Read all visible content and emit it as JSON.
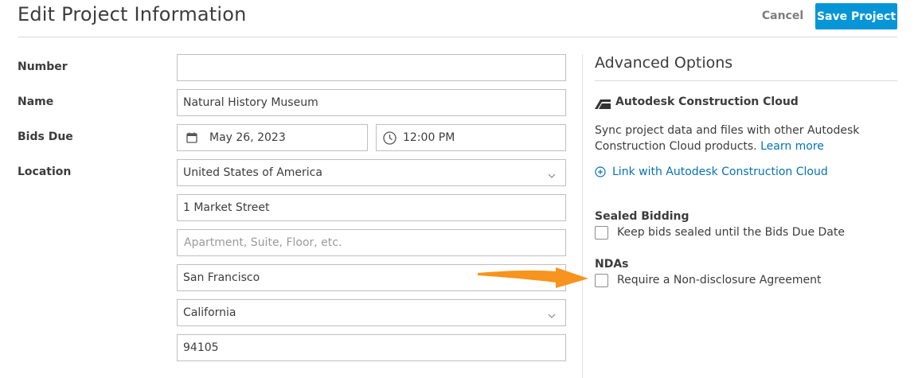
{
  "header": {
    "title": "Edit Project Information",
    "cancel_label": "Cancel",
    "save_label": "Save Project"
  },
  "form": {
    "number": {
      "label": "Number",
      "value": ""
    },
    "name": {
      "label": "Name",
      "value": "Natural History Museum"
    },
    "bids_due": {
      "label": "Bids Due",
      "date": "May 26, 2023",
      "time": "12:00 PM",
      "date_icon": "calendar-icon",
      "time_icon": "clock-icon"
    },
    "location": {
      "label": "Location",
      "country": "United States of America",
      "street": "1 Market Street",
      "apt_placeholder": "Apartment, Suite, Floor, etc.",
      "city": "San Francisco",
      "state": "California",
      "zip": "94105"
    }
  },
  "advanced": {
    "title": "Advanced Options",
    "acc": {
      "logo_icon": "autodesk-logo-icon",
      "title": "Autodesk Construction Cloud",
      "description": "Sync project data and files with other Autodesk Construction Cloud products.",
      "learn_more": "Learn more",
      "link_label": "Link with Autodesk Construction Cloud",
      "link_icon": "plus-circle-icon"
    },
    "sealed_bidding": {
      "title": "Sealed Bidding",
      "checkbox_label": "Keep bids sealed until the Bids Due Date",
      "checked": false
    },
    "ndas": {
      "title": "NDAs",
      "checkbox_label": "Require a Non-disclosure Agreement",
      "checked": false
    }
  },
  "annotation": {
    "arrow_icon": "orange-arrow-icon",
    "color": "#f7941d"
  },
  "colors": {
    "primary": "#0696d7",
    "link": "#0672b3"
  }
}
